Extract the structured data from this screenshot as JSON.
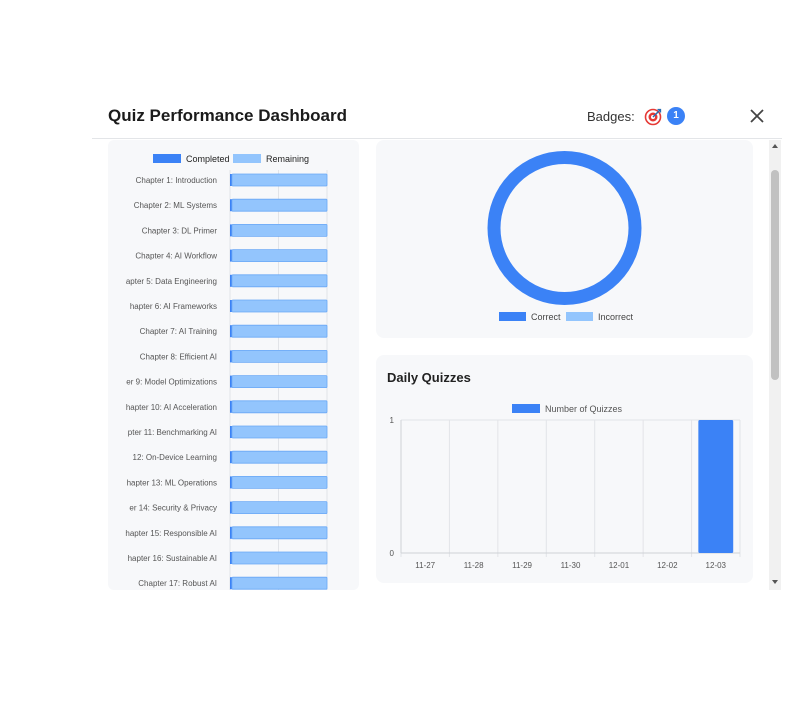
{
  "header": {
    "title": "Quiz Performance Dashboard",
    "badges_label": "Badges:",
    "badge_count": "1",
    "badge_icon": "target-icon"
  },
  "colors": {
    "primary": "#3b82f6",
    "light": "#93c5fd",
    "panel_bg": "#f7f8fa"
  },
  "chart_data": [
    {
      "type": "bar",
      "orientation": "horizontal",
      "stacked": true,
      "legend": [
        "Completed",
        "Remaining"
      ],
      "legend_position": "top",
      "categories": [
        "Chapter 1: Introduction",
        "Chapter 2: ML Systems",
        "Chapter 3: DL Primer",
        "Chapter 4: AI Workflow",
        "apter 5: Data Engineering",
        "hapter 6: AI Frameworks",
        "Chapter 7: AI Training",
        "Chapter 8: Efficient AI",
        "er 9: Model Optimizations",
        "hapter 10: AI Acceleration",
        "pter 11: Benchmarking AI",
        "12: On-Device Learning",
        "hapter 13: ML Operations",
        "er 14: Security & Privacy",
        "hapter 15: Responsible AI",
        "hapter 16: Sustainable AI"
      ],
      "series": [
        {
          "name": "Completed",
          "values": [
            0.02,
            0.02,
            0.02,
            0.02,
            0.02,
            0.02,
            0.02,
            0.02,
            0.02,
            0.02,
            0.02,
            0.02,
            0.02,
            0.02,
            0.02,
            0.02
          ]
        },
        {
          "name": "Remaining",
          "values": [
            0.98,
            0.98,
            0.98,
            0.98,
            0.98,
            0.98,
            0.98,
            0.98,
            0.98,
            0.98,
            0.98,
            0.98,
            0.98,
            0.98,
            0.98,
            0.98
          ]
        }
      ],
      "partial_next_label": "Chapter 17: Robust AI"
    },
    {
      "type": "pie",
      "donut": true,
      "legend": [
        "Correct",
        "Incorrect"
      ],
      "legend_position": "bottom",
      "values": [
        1,
        0
      ]
    },
    {
      "type": "bar",
      "title": "Daily Quizzes",
      "legend": [
        "Number of Quizzes"
      ],
      "legend_position": "top",
      "categories": [
        "11-27",
        "11-28",
        "11-29",
        "11-30",
        "12-01",
        "12-02",
        "12-03"
      ],
      "series": [
        {
          "name": "Number of Quizzes",
          "values": [
            0,
            0,
            0,
            0,
            0,
            0,
            1
          ]
        }
      ],
      "ylim": [
        0,
        1
      ],
      "yticks": [
        "0",
        "1"
      ],
      "grid": true
    }
  ]
}
